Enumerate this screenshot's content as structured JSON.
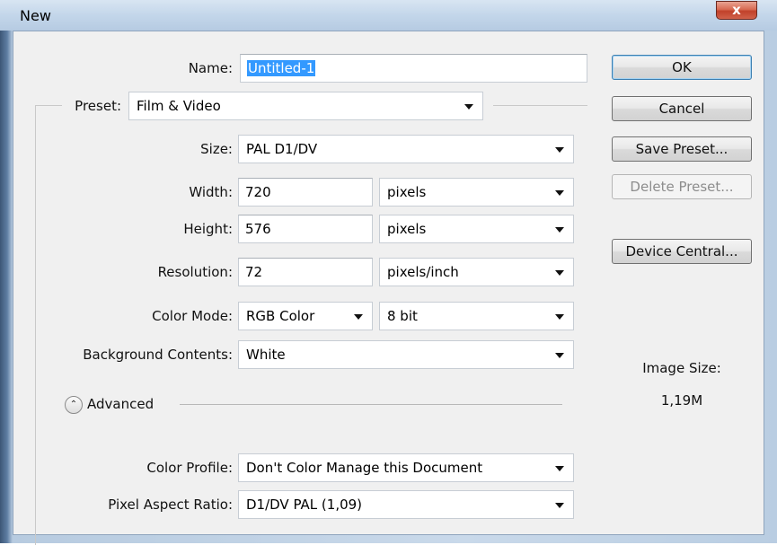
{
  "window": {
    "title": "New",
    "close_glyph": "x"
  },
  "form": {
    "name": {
      "label": "Name:",
      "value": "Untitled-1"
    },
    "preset": {
      "label": "Preset:",
      "value": "Film & Video"
    },
    "size": {
      "label": "Size:",
      "value": "PAL D1/DV"
    },
    "width": {
      "label": "Width:",
      "value": "720",
      "unit": "pixels"
    },
    "height": {
      "label": "Height:",
      "value": "576",
      "unit": "pixels"
    },
    "resolution": {
      "label": "Resolution:",
      "value": "72",
      "unit": "pixels/inch"
    },
    "color_mode": {
      "label": "Color Mode:",
      "value": "RGB Color",
      "depth": "8 bit"
    },
    "background": {
      "label": "Background Contents:",
      "value": "White"
    },
    "advanced": {
      "label": "Advanced"
    },
    "color_profile": {
      "label": "Color Profile:",
      "value": "Don't Color Manage this Document"
    },
    "pixel_aspect": {
      "label": "Pixel Aspect Ratio:",
      "value": "D1/DV PAL (1,09)"
    }
  },
  "buttons": {
    "ok": "OK",
    "cancel": "Cancel",
    "save_preset": "Save Preset...",
    "delete_preset": "Delete Preset...",
    "device_central": "Device Central..."
  },
  "image_size": {
    "label": "Image Size:",
    "value": "1,19M"
  },
  "icons": {
    "advanced_toggle": "double-chevron-up-icon",
    "dropdown": "triangle-down-icon",
    "close": "close-icon"
  },
  "colors": {
    "selection": "#3399ff",
    "title_bar": "#c3d6ea",
    "close_button": "#c1412a"
  }
}
